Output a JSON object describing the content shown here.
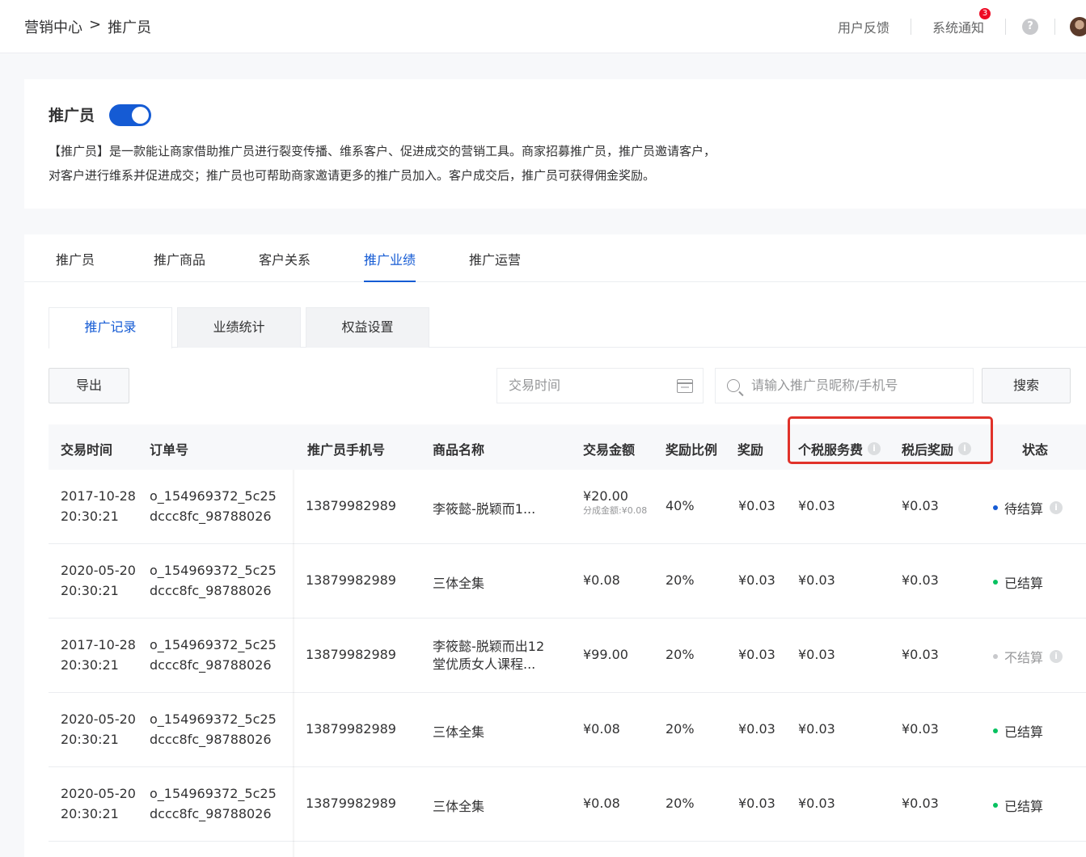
{
  "breadcrumb": [
    "营销中心",
    ">",
    "推广员"
  ],
  "header": {
    "feedback": "用户反馈",
    "notice": "系统通知",
    "notice_count": "3",
    "help": "?"
  },
  "intro": {
    "title": "推广员",
    "enabled": true,
    "desc_line1": "【推广员】是一款能让商家借助推广员进行裂变传播、维系客户、促进成交的营销工具。商家招募推广员，推广员邀请客户，",
    "desc_line2": "对客户进行维系并促进成交；推广员也可帮助商家邀请更多的推广员加入。客户成交后，推广员可获得佣金奖励。"
  },
  "tabs": [
    "推广员",
    "推广商品",
    "客户关系",
    "推广业绩",
    "推广运营"
  ],
  "active_tab": "推广业绩",
  "subtabs": [
    "推广记录",
    "业绩统计",
    "权益设置"
  ],
  "active_subtab": "推广记录",
  "toolbar": {
    "export": "导出",
    "date_placeholder": "交易时间",
    "search_placeholder": "请输入推广员昵称/手机号",
    "search": "搜索"
  },
  "table": {
    "columns": [
      "交易时间",
      "订单号",
      "推广员手机号",
      "商品名称",
      "交易金额",
      "奖励比例",
      "奖励",
      "个税服务费",
      "税后奖励",
      "状态"
    ],
    "rows": [
      {
        "date": "2017-10-28",
        "time": "20:30:21",
        "order1": "o_154969372_5c25",
        "order2": "dccc8fc_98788026",
        "phone": "13879982989",
        "product1": "李筱懿-脱颖而1...",
        "product2": "",
        "amount": "¥20.00",
        "amount_sub": "分成金额:¥0.08",
        "ratio": "40%",
        "reward": "¥0.03",
        "tax": "¥0.03",
        "after_tax": "¥0.03",
        "status": "待结算",
        "status_color": "#155bd4",
        "status_info": true,
        "status_grey": false
      },
      {
        "date": "2020-05-20",
        "time": "20:30:21",
        "order1": "o_154969372_5c25",
        "order2": "dccc8fc_98788026",
        "phone": "13879982989",
        "product1": "三体全集",
        "product2": "",
        "amount": "¥0.08",
        "amount_sub": "",
        "ratio": "20%",
        "reward": "¥0.03",
        "tax": "¥0.03",
        "after_tax": "¥0.03",
        "status": "已结算",
        "status_color": "#07c160",
        "status_info": false,
        "status_grey": false
      },
      {
        "date": "2017-10-28",
        "time": "20:30:21",
        "order1": "o_154969372_5c25",
        "order2": "dccc8fc_98788026",
        "phone": "13879982989",
        "product1": "李筱懿-脱颖而出12",
        "product2": "堂优质女人课程...",
        "amount": "¥99.00",
        "amount_sub": "",
        "ratio": "20%",
        "reward": "¥0.03",
        "tax": "¥0.03",
        "after_tax": "¥0.03",
        "status": "不结算",
        "status_color": "#c8c9cc",
        "status_info": true,
        "status_grey": true
      },
      {
        "date": "2020-05-20",
        "time": "20:30:21",
        "order1": "o_154969372_5c25",
        "order2": "dccc8fc_98788026",
        "phone": "13879982989",
        "product1": "三体全集",
        "product2": "",
        "amount": "¥0.08",
        "amount_sub": "",
        "ratio": "20%",
        "reward": "¥0.03",
        "tax": "¥0.03",
        "after_tax": "¥0.03",
        "status": "已结算",
        "status_color": "#07c160",
        "status_info": false,
        "status_grey": false
      },
      {
        "date": "2020-05-20",
        "time": "20:30:21",
        "order1": "o_154969372_5c25",
        "order2": "dccc8fc_98788026",
        "phone": "13879982989",
        "product1": "三体全集",
        "product2": "",
        "amount": "¥0.08",
        "amount_sub": "",
        "ratio": "20%",
        "reward": "¥0.03",
        "tax": "¥0.03",
        "after_tax": "¥0.03",
        "status": "已结算",
        "status_color": "#07c160",
        "status_info": false,
        "status_grey": false
      }
    ]
  }
}
